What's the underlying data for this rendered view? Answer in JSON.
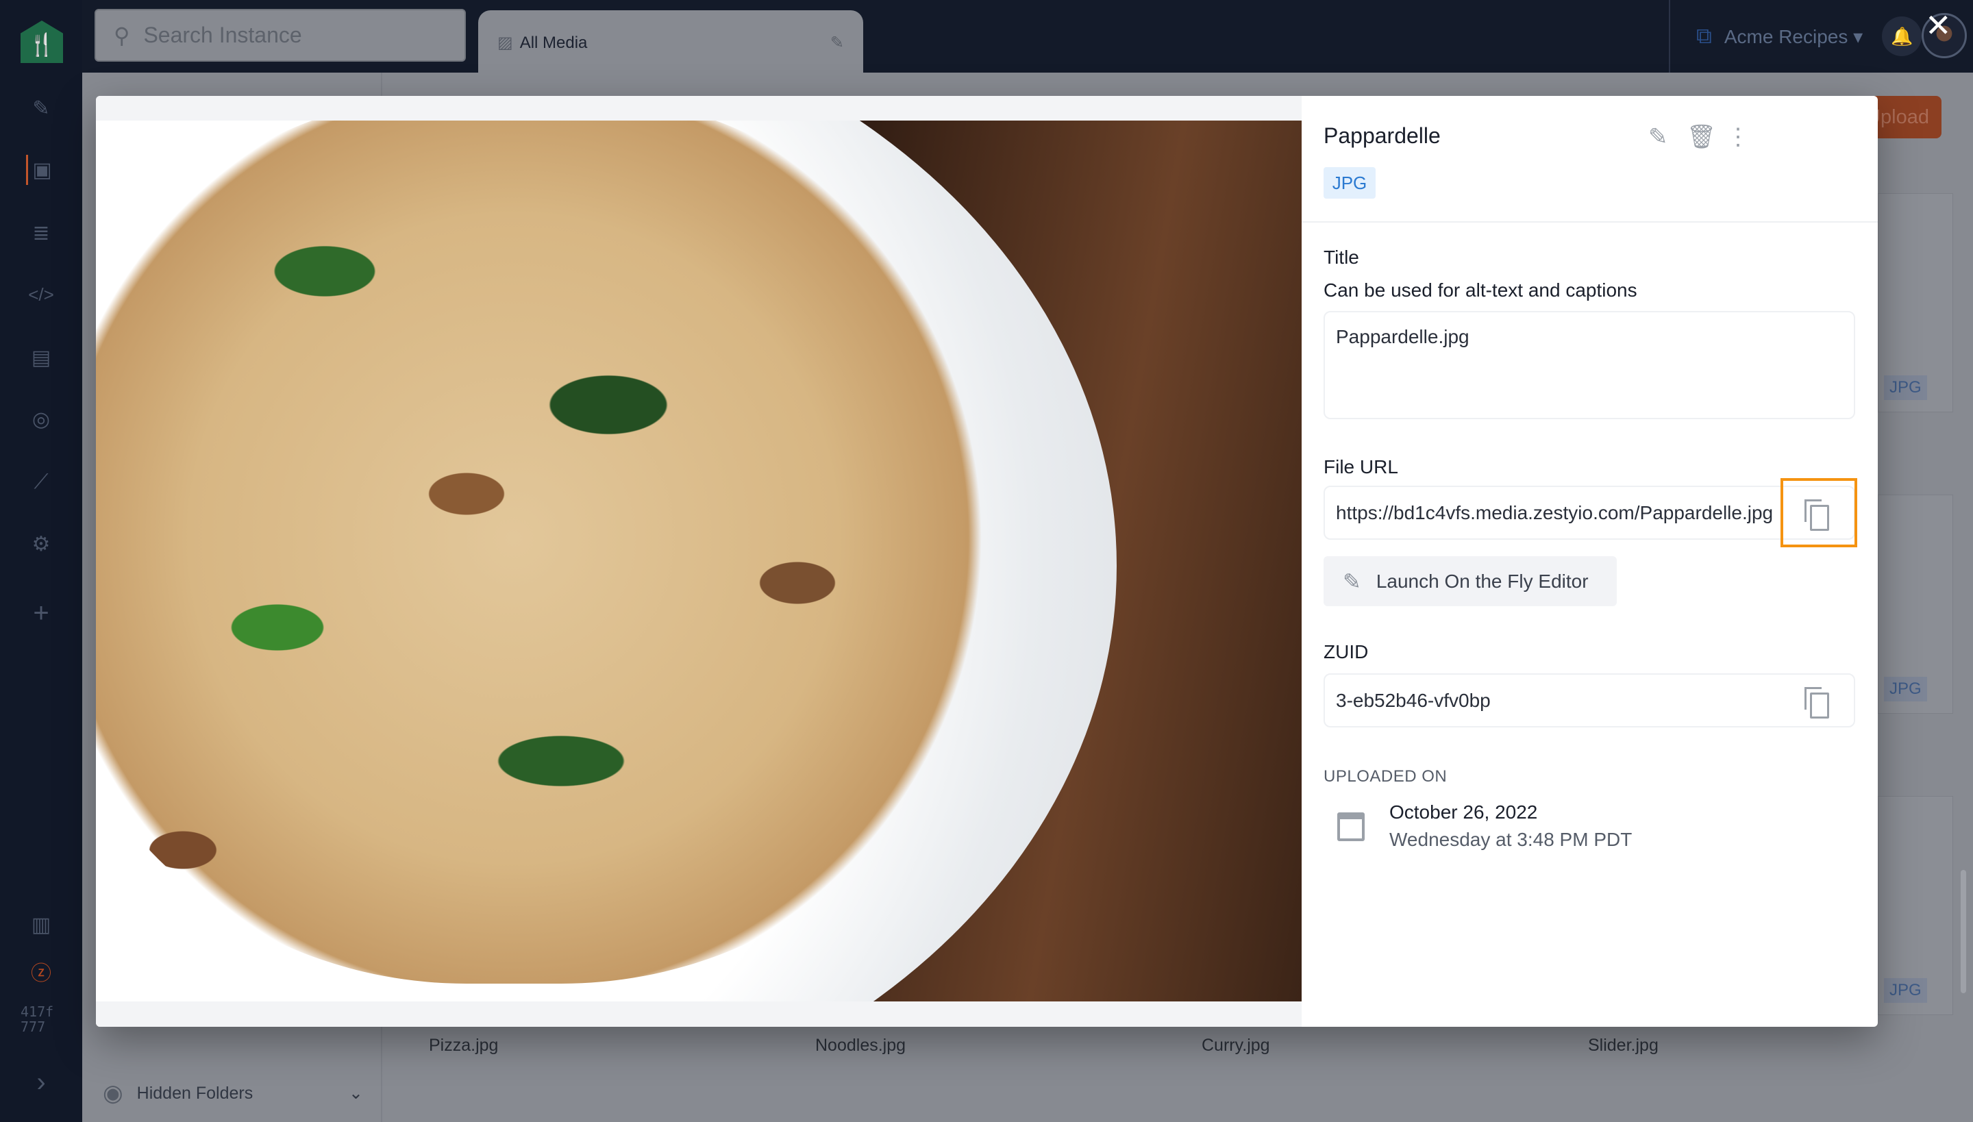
{
  "topbar": {
    "search_placeholder": "Search Instance",
    "tab_label": "All Media",
    "instance_name": "Acme Recipes"
  },
  "sidebar": {
    "version_line1": "417f",
    "version_line2": "777",
    "icons": [
      "utensils-logo-icon",
      "edit-icon",
      "media-icon",
      "database-icon",
      "code-icon",
      "id-card-icon",
      "target-icon",
      "chart-icon",
      "gear-icon",
      "plus-icon",
      "book-icon",
      "zesty-logo-icon",
      "chevron-right-icon"
    ]
  },
  "background": {
    "upload_label": "Upload",
    "hidden_folders": "Hidden Folders",
    "files": [
      "Pizza.jpg",
      "Noodles.jpg",
      "Curry.jpg",
      "Slider.jpg"
    ],
    "badge": "JPG"
  },
  "modal": {
    "title": "Pappardelle",
    "file_type": "JPG",
    "title_label": "Title",
    "title_help": "Can be used for alt-text and captions",
    "title_value": "Pappardelle.jpg",
    "file_url_label": "File URL",
    "file_url": "https://bd1c4vfs.media.zestyio.com/Pappardelle.jpg",
    "launch_label": "Launch On the Fly Editor",
    "zuid_label": "ZUID",
    "zuid": "3-eb52b46-vfv0bp",
    "uploaded_label": "UPLOADED ON",
    "uploaded_date": "October 26, 2022",
    "uploaded_time": "Wednesday at 3:48 PM PDT"
  },
  "colors": {
    "accent": "#2b7ad1",
    "highlight": "#f59311",
    "sidebar": "#111828"
  }
}
